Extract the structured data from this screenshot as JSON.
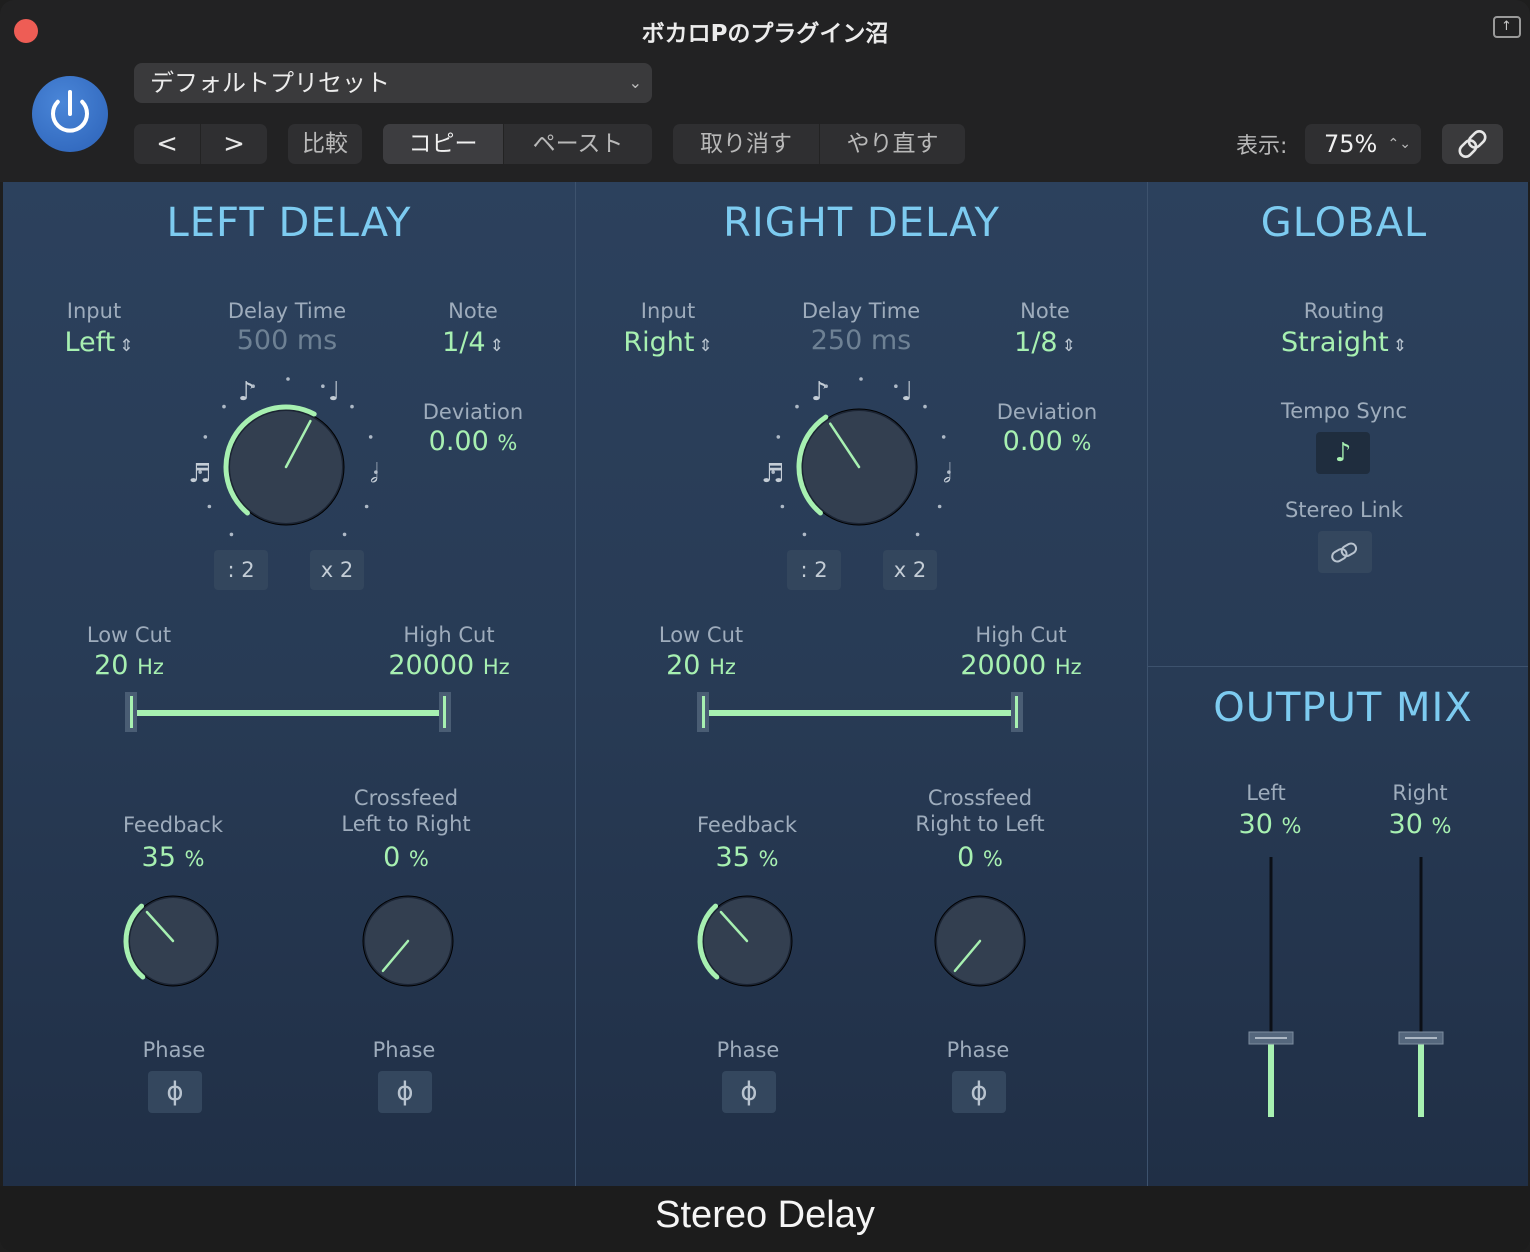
{
  "window": {
    "title": "ボカロPのプラグイン沼",
    "close_color": "#ee5d55"
  },
  "toolbar": {
    "preset": "デフォルトプリセット",
    "prev_glyph": "<",
    "next_glyph": ">",
    "compare": "比較",
    "copy": "コピー",
    "paste": "ペースト",
    "undo": "取り消す",
    "redo": "やり直す",
    "zoom_label": "表示:",
    "zoom_value": "75%"
  },
  "colors": {
    "accent_green": "#a7f0b1",
    "title_blue": "#7dcbf0",
    "power_blue": "#2c62b8"
  },
  "left_delay": {
    "title": "LEFT DELAY",
    "input_label": "Input",
    "input_value": "Left",
    "delay_label": "Delay Time",
    "delay_value": "500 ms",
    "note_label": "Note",
    "note_value": "1/4",
    "deviation_label": "Deviation",
    "deviation_value": "0.00",
    "deviation_unit": "%",
    "half_btn": ": 2",
    "double_btn": "x 2",
    "delay_knob": 0.6,
    "lowcut_label": "Low Cut",
    "lowcut_value": "20",
    "lowcut_unit": "Hz",
    "highcut_label": "High Cut",
    "highcut_value": "20000",
    "highcut_unit": "Hz",
    "feedback_label": "Feedback",
    "feedback_value": "35",
    "feedback_unit": "%",
    "feedback_knob": 0.35,
    "crossfeed_label1": "Crossfeed",
    "crossfeed_label2": "Left to Right",
    "crossfeed_value": "0",
    "crossfeed_unit": "%",
    "crossfeed_knob": 0.0,
    "phase_label_1": "Phase",
    "phase_label_2": "Phase"
  },
  "right_delay": {
    "title": "RIGHT DELAY",
    "input_label": "Input",
    "input_value": "Right",
    "delay_label": "Delay Time",
    "delay_value": "250 ms",
    "note_label": "Note",
    "note_value": "1/8",
    "deviation_label": "Deviation",
    "deviation_value": "0.00",
    "deviation_unit": "%",
    "half_btn": ": 2",
    "double_btn": "x 2",
    "delay_knob": 0.38,
    "lowcut_label": "Low Cut",
    "lowcut_value": "20",
    "lowcut_unit": "Hz",
    "highcut_label": "High Cut",
    "highcut_value": "20000",
    "highcut_unit": "Hz",
    "feedback_label": "Feedback",
    "feedback_value": "35",
    "feedback_unit": "%",
    "feedback_knob": 0.35,
    "crossfeed_label1": "Crossfeed",
    "crossfeed_label2": "Right to Left",
    "crossfeed_value": "0",
    "crossfeed_unit": "%",
    "crossfeed_knob": 0.0,
    "phase_label_1": "Phase",
    "phase_label_2": "Phase"
  },
  "global": {
    "title": "GLOBAL",
    "routing_label": "Routing",
    "routing_value": "Straight",
    "tempo_sync_label": "Tempo Sync",
    "stereo_link_label": "Stereo Link"
  },
  "output_mix": {
    "title": "OUTPUT MIX",
    "left_label": "Left",
    "left_value": "30",
    "left_unit": "%",
    "left_level": 0.3,
    "right_label": "Right",
    "right_value": "30",
    "right_unit": "%",
    "right_level": 0.3
  },
  "footer": {
    "plugin_name": "Stereo Delay"
  }
}
